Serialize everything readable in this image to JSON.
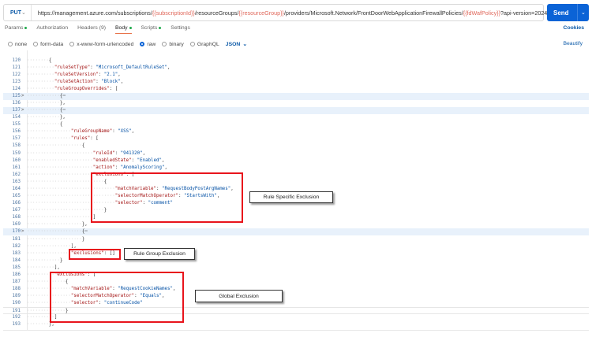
{
  "request": {
    "method": "PUT",
    "url_parts": [
      {
        "t": "https://management.azure.com/subscriptions/",
        "var": false
      },
      {
        "t": "{{subscriptionId}}",
        "var": true
      },
      {
        "t": "/resourceGroups/",
        "var": false
      },
      {
        "t": "{{resourceGroup}}",
        "var": true
      },
      {
        "t": "/providers/Microsoft.Network/FrontDoorWebApplicationFirewallPolicies/",
        "var": false
      },
      {
        "t": "{{fdWafPolicy}}",
        "var": true
      },
      {
        "t": "?api-version=2024-02-01",
        "var": false
      }
    ],
    "send_label": "Send"
  },
  "tabs": [
    {
      "label": "Params",
      "dot": true
    },
    {
      "label": "Authorization",
      "dot": false
    },
    {
      "label": "Headers (9)",
      "dot": false
    },
    {
      "label": "Body",
      "dot": true,
      "active": true
    },
    {
      "label": "Scripts",
      "dot": true
    },
    {
      "label": "Settings",
      "dot": false
    }
  ],
  "cookies_label": "Cookies",
  "body_types": [
    {
      "label": "none",
      "selected": false
    },
    {
      "label": "form-data",
      "selected": false
    },
    {
      "label": "x-www-form-urlencoded",
      "selected": false
    },
    {
      "label": "raw",
      "selected": true
    },
    {
      "label": "binary",
      "selected": false
    },
    {
      "label": "GraphQL",
      "selected": false
    }
  ],
  "format": "JSON",
  "beautify_label": "Beautify",
  "code_lines": [
    {
      "n": "120",
      "i": 8,
      "p": "{"
    },
    {
      "n": "121",
      "i": 10,
      "k": "\"ruleSetType\"",
      "v": "\"Microsoft_DefaultRuleSet\"",
      "p": ","
    },
    {
      "n": "122",
      "i": 10,
      "k": "\"ruleSetVersion\"",
      "v": "\"2.1\"",
      "p": ","
    },
    {
      "n": "123",
      "i": 10,
      "k": "\"ruleSetAction\"",
      "v": "\"Block\"",
      "p": ","
    },
    {
      "n": "124",
      "i": 10,
      "k": "\"ruleGroupOverrides\"",
      "p": "["
    },
    {
      "n": "125",
      "i": 12,
      "p": "{⋯",
      "fold": true
    },
    {
      "n": "136",
      "i": 12,
      "p": "},"
    },
    {
      "n": "137",
      "i": 12,
      "p": "{⋯",
      "fold": true
    },
    {
      "n": "154",
      "i": 12,
      "p": "},"
    },
    {
      "n": "155",
      "i": 12,
      "p": "{"
    },
    {
      "n": "156",
      "i": 16,
      "k": "\"ruleGroupName\"",
      "v": "\"XSS\"",
      "p": ","
    },
    {
      "n": "157",
      "i": 16,
      "k": "\"rules\"",
      "p": "["
    },
    {
      "n": "158",
      "i": 20,
      "p": "{"
    },
    {
      "n": "159",
      "i": 24,
      "k": "\"ruleId\"",
      "v": "\"941320\"",
      "p": ","
    },
    {
      "n": "160",
      "i": 24,
      "k": "\"enabledState\"",
      "v": "\"Enabled\"",
      "p": ","
    },
    {
      "n": "161",
      "i": 24,
      "k": "\"action\"",
      "v": "\"AnomalyScoring\"",
      "p": ","
    },
    {
      "n": "162",
      "i": 24,
      "k": "\"exclusions\"",
      "p": "["
    },
    {
      "n": "163",
      "i": 28,
      "p": "{"
    },
    {
      "n": "164",
      "i": 32,
      "k": "\"matchVariable\"",
      "v": "\"RequestBodyPostArgNames\"",
      "p": ","
    },
    {
      "n": "165",
      "i": 32,
      "k": "\"selectorMatchOperator\"",
      "v": "\"StartsWith\"",
      "p": ","
    },
    {
      "n": "166",
      "i": 32,
      "k": "\"selector\"",
      "v": "\"comment\""
    },
    {
      "n": "167",
      "i": 28,
      "p": "}"
    },
    {
      "n": "168",
      "i": 24,
      "p": "]"
    },
    {
      "n": "169",
      "i": 20,
      "p": "},"
    },
    {
      "n": "170",
      "i": 20,
      "p": "{⋯",
      "fold": true
    },
    {
      "n": "181",
      "i": 20,
      "p": "}"
    },
    {
      "n": "182",
      "i": 16,
      "p": "],"
    },
    {
      "n": "183",
      "i": 16,
      "k": "\"exclusions\"",
      "p": "[]"
    },
    {
      "n": "184",
      "i": 12,
      "p": "}"
    },
    {
      "n": "185",
      "i": 10,
      "p": "],"
    },
    {
      "n": "186",
      "i": 10,
      "k": "\"exclusions\"",
      "p": "["
    },
    {
      "n": "187",
      "i": 14,
      "p": "{"
    },
    {
      "n": "188",
      "i": 16,
      "k": "\"matchVariable\"",
      "v": "\"RequestCookieNames\"",
      "p": ","
    },
    {
      "n": "189",
      "i": 16,
      "k": "\"selectorMatchOperator\"",
      "v": "\"Equals\"",
      "p": ","
    },
    {
      "n": "190",
      "i": 16,
      "k": "\"selector\"",
      "v": "\"continueCode\""
    },
    {
      "n": "191",
      "i": 14,
      "p": "}",
      "current": true
    },
    {
      "n": "192",
      "i": 10,
      "p": "]"
    },
    {
      "n": "193",
      "i": 8,
      "p": "},"
    }
  ],
  "annotations": {
    "rule_specific": "Rule Specific Exclusion",
    "rule_group": "Rule Group Exclusion",
    "global": "Global Exclusion"
  },
  "colors": {
    "accent": "#0b63d6",
    "annotation": "#e8141c",
    "key": "#a31515",
    "value": "#0451a5"
  }
}
